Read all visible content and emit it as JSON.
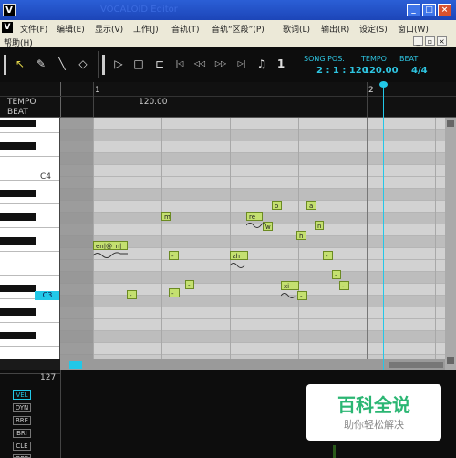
{
  "window": {
    "app_icon": "V",
    "title": "VOCALOID Editor",
    "min": "_",
    "max": "□",
    "close": "×"
  },
  "menu": [
    {
      "label": "文件(F)"
    },
    {
      "label": "编辑(E)"
    },
    {
      "label": "显示(V)"
    },
    {
      "label": "工作(J)"
    },
    {
      "label": "音轨(T)"
    },
    {
      "label": "音轨“区段”(P)"
    },
    {
      "label": "歌词(L)"
    },
    {
      "label": "输出(R)"
    },
    {
      "label": "设定(S)"
    },
    {
      "label": "窗口(W)"
    },
    {
      "label": "帮助(H)"
    }
  ],
  "toolbar": {
    "song_pos_label": "SONG POS.",
    "song_pos": "2 : 1 : 120",
    "tempo_label": "TEMPO",
    "tempo": "120.00",
    "beat_label": "BEAT",
    "beat": "4/4"
  },
  "ruler": {
    "tempo_label": "TEMPO",
    "beat_label": "BEAT",
    "measure1": "1",
    "measure2": "2",
    "tempo_value": "120.00"
  },
  "keys": {
    "c4": "C4",
    "c3": "C3"
  },
  "notes": [
    {
      "lyric": "en|@_n|"
    },
    {
      "lyric": "m"
    },
    {
      "lyric": "-"
    },
    {
      "lyric": "-"
    },
    {
      "lyric": "-"
    },
    {
      "lyric": "-"
    },
    {
      "lyric": "zh_"
    },
    {
      "lyric": "re_"
    },
    {
      "lyric": "w"
    },
    {
      "lyric": "o"
    },
    {
      "lyric": "a"
    },
    {
      "lyric": "n"
    },
    {
      "lyric": "h"
    },
    {
      "lyric": "-"
    },
    {
      "lyric": "-"
    },
    {
      "lyric": "-"
    },
    {
      "lyric": "xi_"
    },
    {
      "lyric": "-"
    },
    {
      "lyric": "-"
    }
  ],
  "control": {
    "max_value": "127",
    "buttons": [
      "VEL",
      "DYN",
      "BRE",
      "BRI",
      "CLE",
      "OPE"
    ]
  },
  "watermark": {
    "title": "百科全说",
    "subtitle": "助你轻松解决"
  }
}
